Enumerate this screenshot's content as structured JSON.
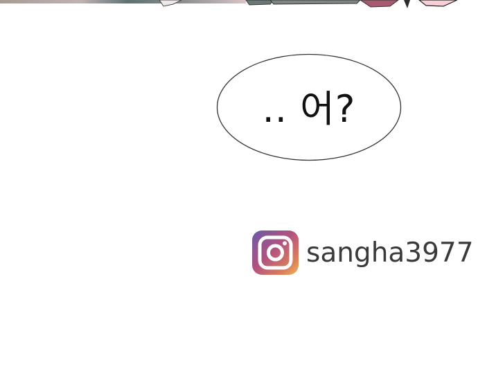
{
  "panel": {
    "bubble_text": ".. 어?"
  },
  "social": {
    "icon": "instagram-icon",
    "handle": "sangha3977"
  },
  "colors": {
    "background": "#ffffff",
    "bubble_outline": "#333333",
    "handle_text": "#3a3a3a"
  }
}
